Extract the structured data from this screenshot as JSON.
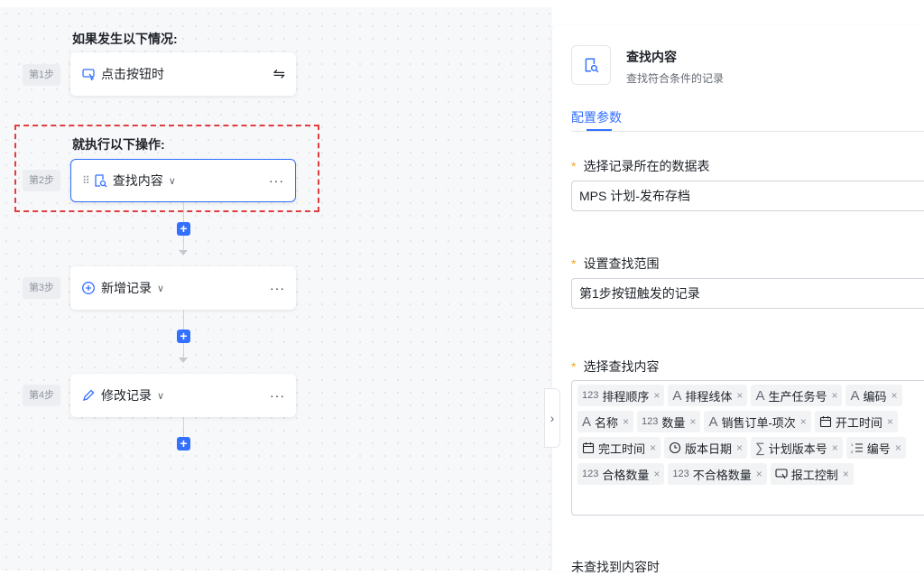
{
  "flow": {
    "trigger_title": "如果发生以下情况:",
    "action_title": "就执行以下操作:",
    "steps": [
      {
        "tag": "第1步",
        "label": "点击按钮时"
      },
      {
        "tag": "第2步",
        "label": "查找内容"
      },
      {
        "tag": "第3步",
        "label": "新增记录"
      },
      {
        "tag": "第4步",
        "label": "修改记录"
      }
    ],
    "more": "···",
    "plus": "+"
  },
  "panel": {
    "title": "查找内容",
    "subtitle": "查找符合条件的记录",
    "tab": "配置参数",
    "field_table_label": "选择记录所在的数据表",
    "field_table_value": "MPS 计划-发布存档",
    "field_range_label": "设置查找范围",
    "field_range_value": "第1步按钮触发的记录",
    "field_content_label": "选择查找内容",
    "tags": [
      {
        "icon": "123",
        "label": "排程顺序"
      },
      {
        "icon": "A",
        "label": "排程线体"
      },
      {
        "icon": "A",
        "label": "生产任务号"
      },
      {
        "icon": "A",
        "label": "编码"
      },
      {
        "icon": "A",
        "label": "名称"
      },
      {
        "icon": "123",
        "label": "数量"
      },
      {
        "icon": "A",
        "label": "销售订单-项次"
      },
      {
        "icon": "calendar",
        "label": "开工时间"
      },
      {
        "icon": "calendar",
        "label": "完工时间"
      },
      {
        "icon": "clock",
        "label": "版本日期"
      },
      {
        "icon": "sum",
        "label": "计划版本号"
      },
      {
        "icon": "list",
        "label": "编号"
      },
      {
        "icon": "123",
        "label": "合格数量"
      },
      {
        "icon": "123",
        "label": "不合格数量"
      },
      {
        "icon": "button",
        "label": "报工控制"
      }
    ],
    "not_found_label": "未查找到内容时",
    "required_mark": "*",
    "remove_mark": "×"
  },
  "colors": {
    "accent": "#3370ff",
    "highlight_dash": "#e03e3e",
    "required": "#f5a623"
  }
}
